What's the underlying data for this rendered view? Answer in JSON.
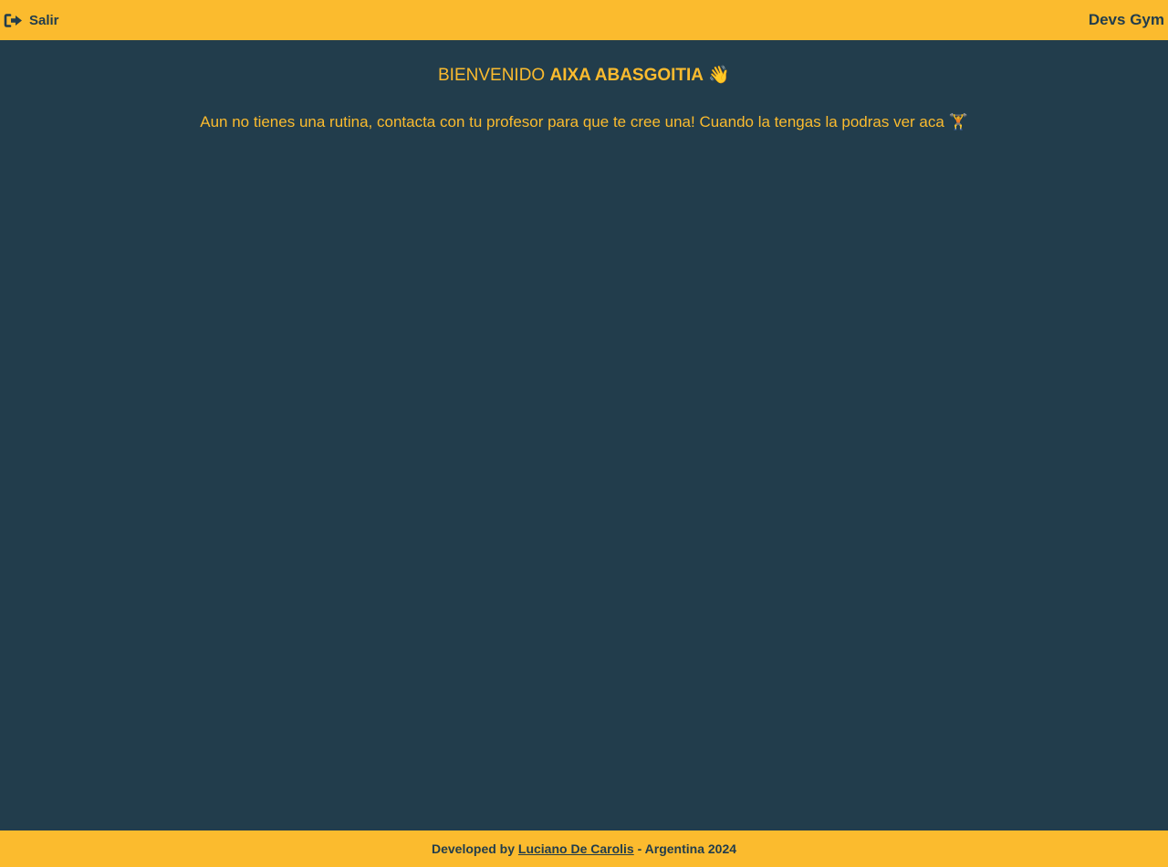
{
  "header": {
    "logout_label": "Salir",
    "logout_icon": "logout-icon",
    "brand": "Devs Gym"
  },
  "main": {
    "welcome_prefix": "BIENVENIDO ",
    "user_name": "AIXA ABASGOITIA",
    "welcome_emoji": "👋",
    "no_routine_message": "Aun no tienes una rutina, contacta con tu profesor para que te cree una! Cuando la tengas la podras ver aca",
    "message_emoji": "🏋️"
  },
  "footer": {
    "prefix": "Developed by ",
    "author_link": "Luciano De Carolis",
    "suffix": " - Argentina 2024"
  },
  "colors": {
    "accent": "#fbbb2e",
    "background": "#223d4c"
  }
}
